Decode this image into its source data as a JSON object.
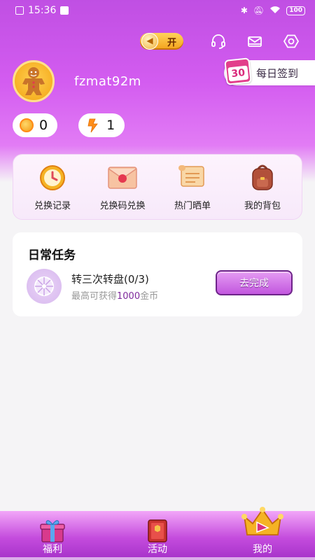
{
  "status_bar": {
    "time": "15:36",
    "battery": "100"
  },
  "header": {
    "sound_toggle_label": "开"
  },
  "profile": {
    "username": "fzmat92m"
  },
  "signin": {
    "day": "30",
    "label": "每日签到"
  },
  "currencies": [
    {
      "icon": "coin-icon",
      "value": "0"
    },
    {
      "icon": "lightning-icon",
      "value": "1"
    }
  ],
  "menu": {
    "items": [
      {
        "label": "兑换记录",
        "icon": "clock-icon"
      },
      {
        "label": "兑换码兑换",
        "icon": "envelope-icon"
      },
      {
        "label": "热门晒单",
        "icon": "scroll-icon"
      },
      {
        "label": "我的背包",
        "icon": "backpack-icon"
      }
    ]
  },
  "daily_tasks": {
    "title": "日常任务",
    "task": {
      "name": "转三次转盘(0/3)",
      "reward_prefix": "最高可获得",
      "reward_amount": "1000",
      "reward_suffix": "金币",
      "button_label": "去完成"
    }
  },
  "bottom_nav": {
    "items": [
      {
        "label": "福利",
        "icon": "gift-icon"
      },
      {
        "label": "活动",
        "icon": "book-icon"
      },
      {
        "label": "我的",
        "icon": "crown-icon"
      }
    ],
    "active": "我的"
  },
  "colors": {
    "brand": "#c04fe3",
    "coin": "#f29a14",
    "task_highlight": "#7f2a9c"
  }
}
